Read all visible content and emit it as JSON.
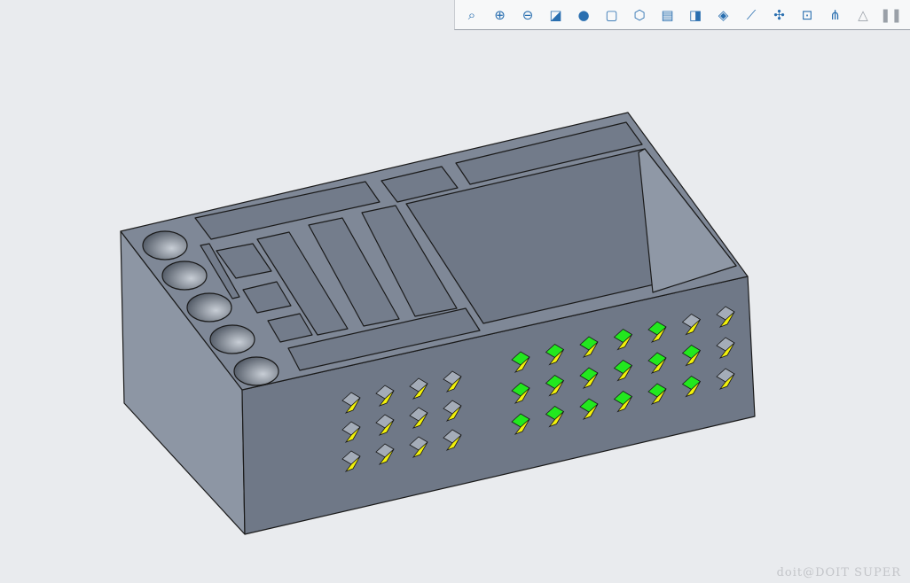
{
  "toolbar": {
    "buttons": [
      {
        "name": "refit-icon",
        "glyph": "⌕"
      },
      {
        "name": "zoom-in-icon",
        "glyph": "⊕"
      },
      {
        "name": "zoom-out-icon",
        "glyph": "⊖"
      },
      {
        "name": "repaint-icon",
        "glyph": "◪"
      },
      {
        "name": "display-style-icon",
        "glyph": "●"
      },
      {
        "name": "standard-orientation-icon",
        "glyph": "▢"
      },
      {
        "name": "saved-orientations-icon",
        "glyph": "⬡"
      },
      {
        "name": "view-manager-icon",
        "glyph": "▤"
      },
      {
        "name": "perspective-view-icon",
        "glyph": "◨"
      },
      {
        "name": "section-view-icon",
        "glyph": "◈"
      },
      {
        "name": "datum-display-icon",
        "glyph": "⟋"
      },
      {
        "name": "annotation-display-icon",
        "glyph": "✣"
      },
      {
        "name": "appearance-icon",
        "glyph": "⊡"
      },
      {
        "name": "network-icon",
        "glyph": "⋔"
      },
      {
        "name": "triangle-icon",
        "glyph": "△"
      },
      {
        "name": "pause-icon",
        "glyph": "❚❚"
      }
    ]
  },
  "colors": {
    "background": "#e9ebee",
    "body": "#7c8594",
    "front": "#6f7887",
    "edge": "#1a1a1a",
    "marker_yellow": "#f3f20a",
    "marker_green": "#22e81e"
  },
  "watermark": "doit@DOIT SUPER"
}
